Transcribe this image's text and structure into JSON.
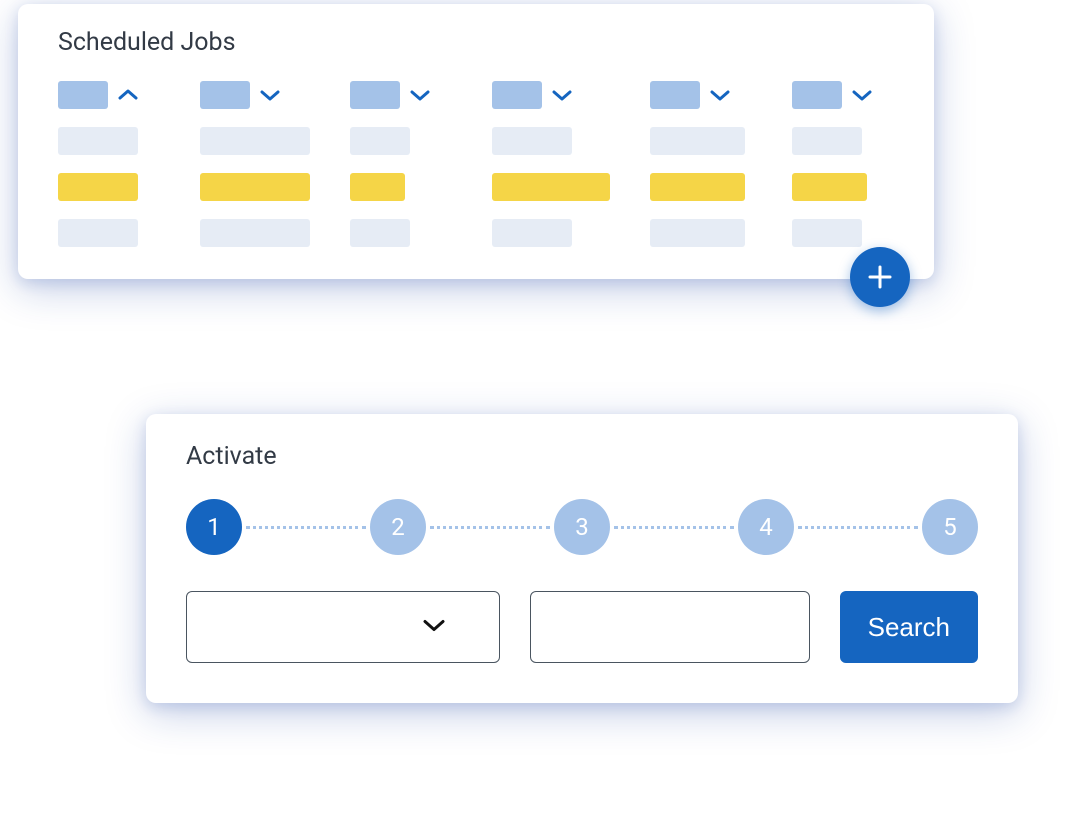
{
  "jobs_card": {
    "title": "Scheduled Jobs",
    "columns": [
      {
        "sort": "asc"
      },
      {
        "sort": "desc"
      },
      {
        "sort": "desc"
      },
      {
        "sort": "desc"
      },
      {
        "sort": "desc"
      },
      {
        "sort": "desc"
      }
    ],
    "fab_icon": "plus-icon"
  },
  "activate_card": {
    "title": "Activate",
    "steps": [
      "1",
      "2",
      "3",
      "4",
      "5"
    ],
    "active_step": 1,
    "select_value": "",
    "input_value": "",
    "search_label": "Search"
  },
  "colors": {
    "primary": "#1565C0",
    "light_blue": "#A4C2E8",
    "pale": "#E6ECF5",
    "yellow": "#F5D547"
  }
}
